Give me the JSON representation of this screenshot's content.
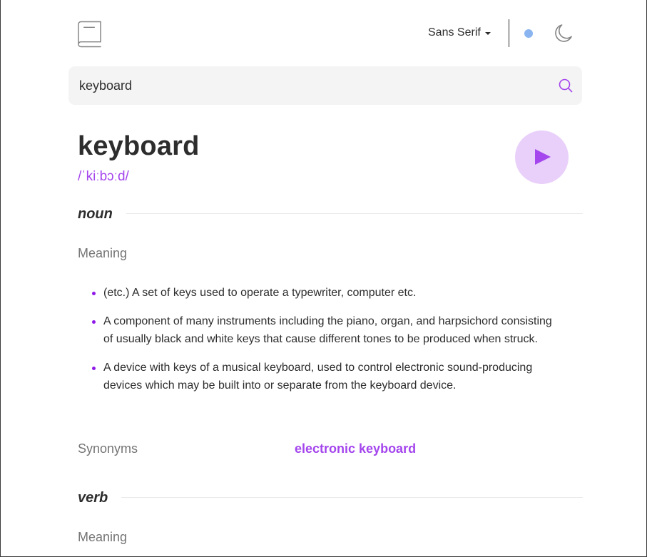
{
  "header": {
    "font_selector": "Sans Serif",
    "logo_icon": "book-icon",
    "theme_toggle_icon": "toggle-dot",
    "theme_icon": "moon-icon"
  },
  "search": {
    "value": "keyboard",
    "icon": "search-icon"
  },
  "entry": {
    "word": "keyboard",
    "phonetic": "/ˈkiːbɔːd/",
    "play_icon": "play-icon"
  },
  "noun": {
    "part_of_speech": "noun",
    "meaning_label": "Meaning",
    "definitions": [
      "(etc.) A set of keys used to operate a typewriter, computer etc.",
      "A component of many instruments including the piano, organ, and harpsichord consisting of usually black and white keys that cause different tones to be produced when struck.",
      "A device with keys of a musical keyboard, used to control electronic sound-producing devices which may be built into or separate from the keyboard device."
    ],
    "synonyms_label": "Synonyms",
    "synonyms": [
      "electronic keyboard"
    ]
  },
  "verb": {
    "part_of_speech": "verb",
    "meaning_label": "Meaning"
  },
  "colors": {
    "accent": "#a445ed",
    "play_bg": "#e9d0fa",
    "toggle": "#8ab4f0",
    "text": "#2d2d2d",
    "muted": "#757575",
    "search_bg": "#f4f4f4"
  }
}
